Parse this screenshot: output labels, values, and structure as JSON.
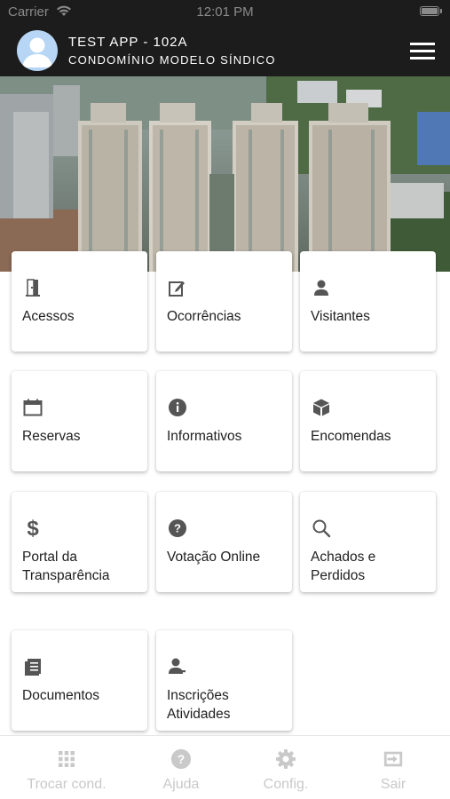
{
  "status_bar": {
    "carrier": "Carrier",
    "time": "12:01 PM"
  },
  "header": {
    "title": "TEST APP - 102A",
    "subtitle": "CONDOMÍNIO MODELO SÍNDICO",
    "menu_icon": "hamburger-icon",
    "avatar_icon": "user-avatar-icon"
  },
  "hero": {
    "image": "city-buildings-photo"
  },
  "menu_cards": [
    {
      "label": "Acessos",
      "icon": "door-icon"
    },
    {
      "label": "Ocorrências",
      "icon": "edit-note-icon"
    },
    {
      "label": "Visitantes",
      "icon": "person-icon"
    },
    {
      "label": "Reservas",
      "icon": "calendar-icon"
    },
    {
      "label": "Informativos",
      "icon": "info-icon"
    },
    {
      "label": "Encomendas",
      "icon": "package-icon"
    },
    {
      "label": "Portal da Transparência",
      "icon": "dollar-icon"
    },
    {
      "label": "Votação Online",
      "icon": "help-circle-icon"
    },
    {
      "label": "Achados e Perdidos",
      "icon": "search-icon"
    },
    {
      "label": "Documentos",
      "icon": "document-icon"
    },
    {
      "label": "Inscrições Atividades",
      "icon": "person-signup-icon"
    }
  ],
  "tab_bar": [
    {
      "label": "Trocar cond.",
      "icon": "grid-icon"
    },
    {
      "label": "Ajuda",
      "icon": "help-icon"
    },
    {
      "label": "Config.",
      "icon": "gear-icon"
    },
    {
      "label": "Sair",
      "icon": "exit-icon"
    }
  ],
  "colors": {
    "header_bg": "#1c1c1c",
    "avatar_bg": "#b7d6f5",
    "card_icon": "#555555",
    "tab_inactive": "#c9c9c9"
  }
}
